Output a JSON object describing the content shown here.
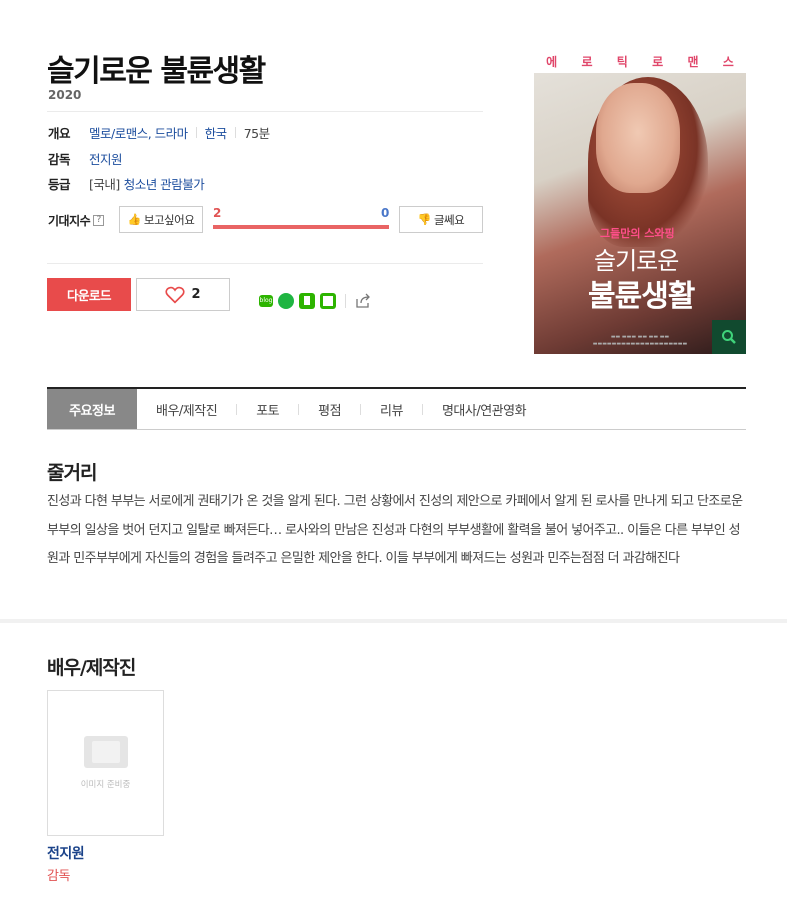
{
  "movie": {
    "title": "슬기로운 불륜생활",
    "year": "2020",
    "overview_label": "개요",
    "genre": "멜로/로맨스, 드라마",
    "country": "한국",
    "runtime": "75분",
    "director_label": "감독",
    "director": "전지원",
    "rating_label": "등급",
    "rating_prefix": "[국내]",
    "rating": "청소년 관람불가"
  },
  "expectation": {
    "label": "기대지수",
    "help": "?",
    "like_label": "보고싶어요",
    "dislike_label": "글쎄요",
    "like_count": "2",
    "dislike_count": "0"
  },
  "actions": {
    "download_label": "다운로드",
    "heart_count": "2"
  },
  "poster": {
    "top_chars": [
      "에",
      "로",
      "틱",
      "로",
      "맨",
      "스"
    ],
    "subtitle": "그들만의 스와핑",
    "title_line1": "슬기로운",
    "title_line2": "불륜생활"
  },
  "tabs": [
    {
      "label": "주요정보"
    },
    {
      "label": "배우/제작진"
    },
    {
      "label": "포토"
    },
    {
      "label": "평점"
    },
    {
      "label": "리뷰"
    },
    {
      "label": "명대사/연관영화"
    }
  ],
  "synopsis": {
    "heading": "줄거리",
    "text": "진성과 다현 부부는 서로에게 권태기가 온 것을 알게 된다. 그런 상황에서 진성의 제안으로 카페에서 알게 된 로사를 만나게 되고 단조로운 부부의 일상을 벗어 던지고 일탈로 빠져든다… 로사와의 만남은 진성과 다현의 부부생활에 활력을 불어 넣어주고.. 이들은 다른 부부인 성원과 민주부부에게 자신들의 경험을 들려주고 은밀한 제안을 한다. 이들 부부에게 빠져드는 성원과 민주는점점 더 과감해진다"
  },
  "cast": {
    "heading": "배우/제작진",
    "members": [
      {
        "placeholder": "이미지 준비중",
        "name": "전지원",
        "role": "감독"
      }
    ]
  },
  "colors": {
    "accent_red": "#e84b4b",
    "link_blue": "#1d4e9e",
    "active_tab": "#888888"
  }
}
